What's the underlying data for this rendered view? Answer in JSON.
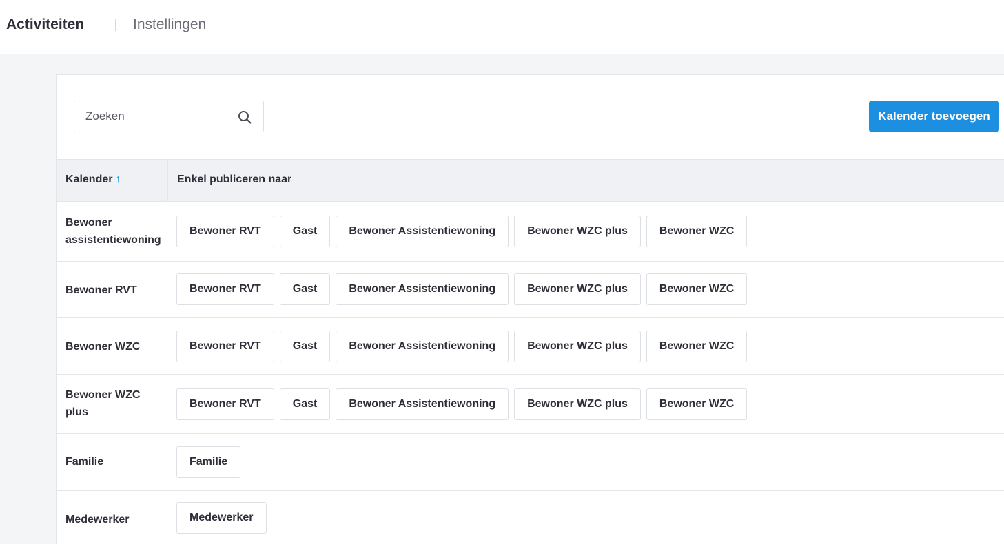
{
  "nav": {
    "tab_active": "Activiteiten",
    "tab_other": "Instellingen"
  },
  "toolbar": {
    "search_placeholder": "Zoeken",
    "add_button": "Kalender toevoegen"
  },
  "table": {
    "col_calendar": "Kalender",
    "sort_icon": "↑",
    "col_publish": "Enkel publiceren naar",
    "rows": [
      {
        "label": "Bewoner assistentiewoning",
        "tags": [
          "Bewoner RVT",
          "Gast",
          "Bewoner Assistentiewoning",
          "Bewoner WZC plus",
          "Bewoner WZC"
        ]
      },
      {
        "label": "Bewoner RVT",
        "tags": [
          "Bewoner RVT",
          "Gast",
          "Bewoner Assistentiewoning",
          "Bewoner WZC plus",
          "Bewoner WZC"
        ]
      },
      {
        "label": "Bewoner WZC",
        "tags": [
          "Bewoner RVT",
          "Gast",
          "Bewoner Assistentiewoning",
          "Bewoner WZC plus",
          "Bewoner WZC"
        ]
      },
      {
        "label": "Bewoner WZC plus",
        "tags": [
          "Bewoner RVT",
          "Gast",
          "Bewoner Assistentiewoning",
          "Bewoner WZC plus",
          "Bewoner WZC"
        ]
      },
      {
        "label": "Familie",
        "tags": [
          "Familie"
        ]
      },
      {
        "label": "Medewerker",
        "tags": [
          "Medewerker"
        ]
      }
    ]
  },
  "colors": {
    "accent": "#1d8fe0",
    "header_bg": "#eff1f5",
    "page_bg": "#f4f5f7"
  }
}
